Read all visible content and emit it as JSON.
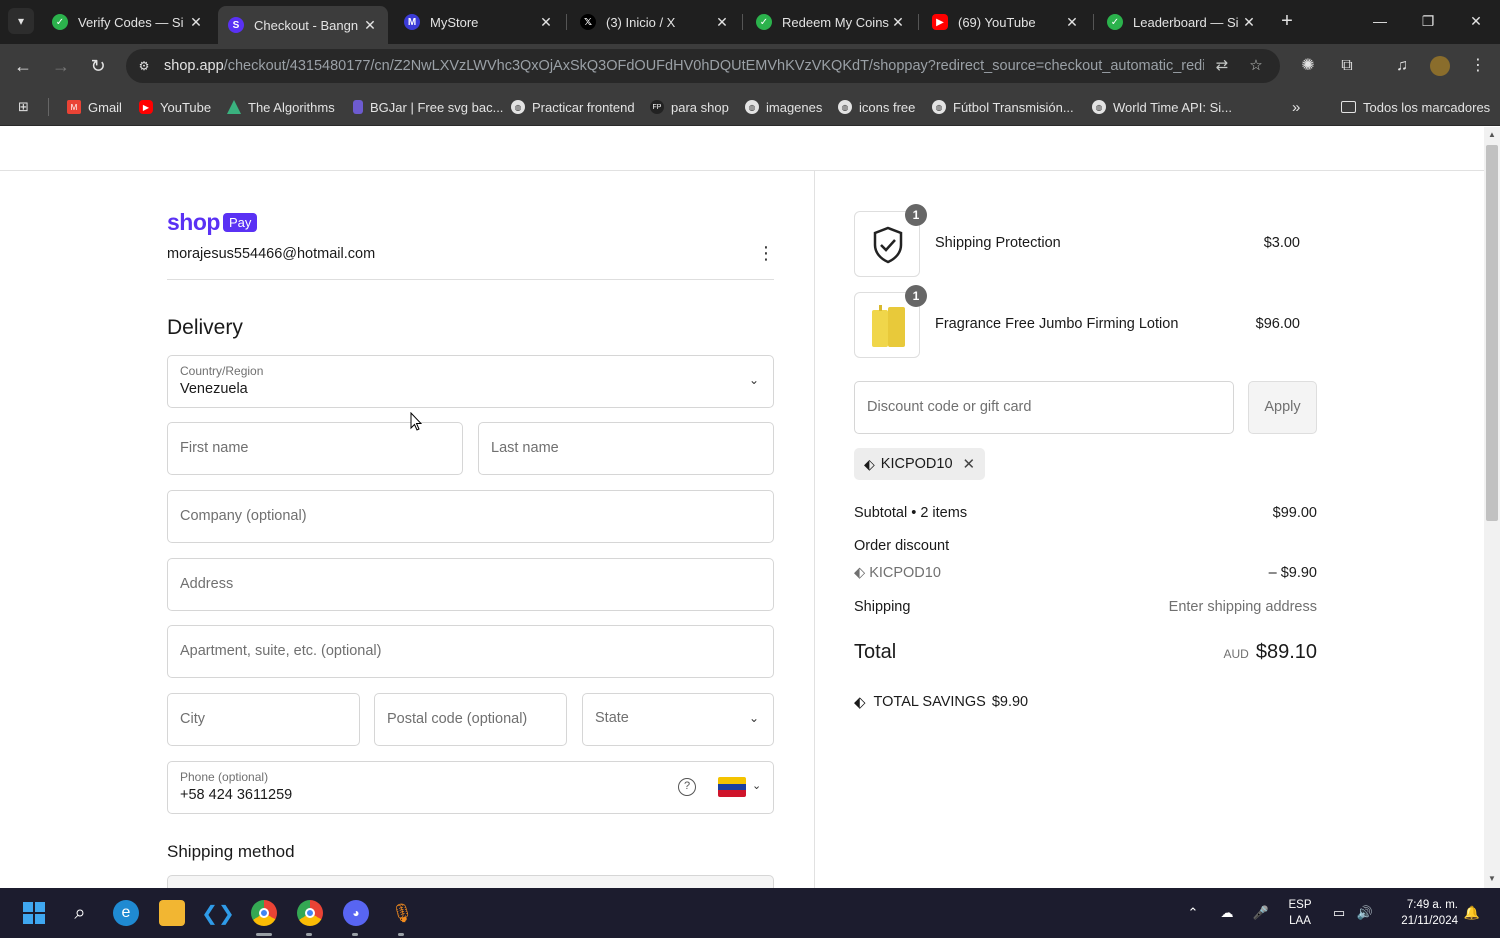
{
  "browser": {
    "tabs": [
      {
        "title": "Verify Codes — Si",
        "favicon_color": "#2bb24c",
        "favicon": "check-circle-icon"
      },
      {
        "title": "Checkout - Bangn",
        "favicon_color": "#5a31f4",
        "favicon": "shop-icon"
      },
      {
        "title": "MyStore",
        "favicon_color": "#3b3bd6",
        "favicon": "store-icon"
      },
      {
        "title": "(3) Inicio / X",
        "favicon_color": "#000000",
        "favicon": "x-icon"
      },
      {
        "title": "Redeem My Coins",
        "favicon_color": "#2bb24c",
        "favicon": "check-circle-icon"
      },
      {
        "title": "(69) YouTube",
        "favicon_color": "#ff0000",
        "favicon": "youtube-icon"
      },
      {
        "title": "Leaderboard — Si",
        "favicon_color": "#2bb24c",
        "favicon": "check-circle-icon"
      }
    ],
    "url_host": "shop.app",
    "url_path": "/checkout/4315480177/cn/Z2NwLXVzLWVhc3QxOjAxSkQ3OFdOUFdHV0hDQUtEMVhKVzVKQKdT/shoppay?redirect_source=checkout_automatic_redir...",
    "bookmarks": [
      {
        "label": "Gmail",
        "color": "#ea4335"
      },
      {
        "label": "YouTube",
        "color": "#ff0000"
      },
      {
        "label": "The Algorithms",
        "color": "#3ab27f"
      },
      {
        "label": "BGJar | Free svg bac...",
        "color": "#6d5bd0"
      },
      {
        "label": "Practicar frontend",
        "color": "#e3e3e3"
      },
      {
        "label": "para shop",
        "color": "#222222"
      },
      {
        "label": "imagenes",
        "color": "#e3e3e3"
      },
      {
        "label": "icons free",
        "color": "#e3e3e3"
      },
      {
        "label": "Fútbol Transmisión...",
        "color": "#e3e3e3"
      },
      {
        "label": "World Time API: Si...",
        "color": "#e3e3e3"
      }
    ],
    "all_bookmarks": "Todos los marcadores"
  },
  "checkout": {
    "brand_shop": "shop",
    "brand_pay": "Pay",
    "email": "morajesus554466@hotmail.com",
    "delivery_heading": "Delivery",
    "country_label": "Country/Region",
    "country_value": "Venezuela",
    "first_name_ph": "First name",
    "last_name_ph": "Last name",
    "company_ph": "Company (optional)",
    "address_ph": "Address",
    "apartment_ph": "Apartment, suite, etc. (optional)",
    "city_ph": "City",
    "postal_ph": "Postal code (optional)",
    "state_ph": "State",
    "phone_label": "Phone (optional)",
    "phone_value": "+58 424 3611259",
    "shipping_method_heading": "Shipping method"
  },
  "summary": {
    "items": [
      {
        "name": "Shipping Protection",
        "price": "$3.00",
        "qty": "1"
      },
      {
        "name": "Fragrance Free Jumbo Firming Lotion",
        "price": "$96.00",
        "qty": "1"
      }
    ],
    "discount_ph": "Discount code or gift card",
    "apply_label": "Apply",
    "applied_code": "KICPOD10",
    "subtotal_label": "Subtotal • 2 items",
    "subtotal_value": "$99.00",
    "order_discount_label": "Order discount",
    "discount_code": "KICPOD10",
    "discount_value": "– $9.90",
    "shipping_label": "Shipping",
    "shipping_value": "Enter shipping address",
    "total_label": "Total",
    "total_currency": "AUD",
    "total_value": "$89.10",
    "savings_label": "TOTAL SAVINGS",
    "savings_value": "$9.90"
  },
  "taskbar": {
    "lang_top": "ESP",
    "lang_bottom": "LAA",
    "time": "7:49 a. m.",
    "date": "21/11/2024"
  },
  "colors": {
    "shop_purple": "#5a31f4",
    "chrome_dark": "#1f1f1f",
    "chrome_mid": "#3c3c3c"
  }
}
